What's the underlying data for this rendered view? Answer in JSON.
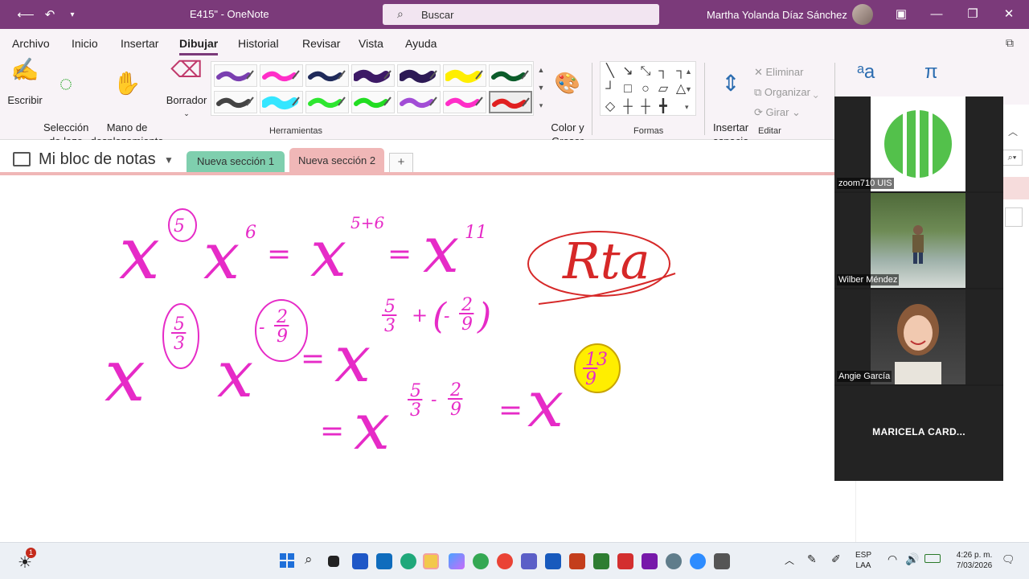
{
  "app": {
    "title": "E415\"  -  OneNote",
    "search_placeholder": "Buscar",
    "user_name": "Martha Yolanda Díaz Sánchez"
  },
  "menu": {
    "items": [
      "Archivo",
      "Inicio",
      "Insertar",
      "Dibujar",
      "Historial",
      "Revisar",
      "Vista",
      "Ayuda"
    ],
    "active": "Dibujar"
  },
  "ribbon": {
    "write": "Escribir",
    "lasso": "Selección\nde lazo",
    "hand": "Mano de\ndesplazamiento",
    "eraser": "Borrador",
    "color": "Color y\nGrosor",
    "insert_space": "Insertar\nespacio",
    "delete": "Eliminar",
    "arrange": "Organizar",
    "rotate": "Girar",
    "groups": {
      "tools": "Herramientas",
      "shapes": "Formas",
      "edit": "Editar"
    },
    "pen_colors": [
      "#7a3fb0",
      "#ff2ec8",
      "#1f2a5a",
      "#3d1a66",
      "#2d1a55",
      "#ffee00",
      "#0b5c2a",
      "#444444",
      "#35e6ff",
      "#2ee630",
      "#22dd22",
      "#a24dd6",
      "#ff2ec8",
      "#e02020"
    ]
  },
  "notebook": {
    "name": "Mi bloc de notas",
    "sections": [
      "Nueva sección 1",
      "Nueva sección 2"
    ],
    "add": "+"
  },
  "ink": {
    "line1": [
      "x",
      "5",
      "x",
      "6",
      "=",
      "x",
      "5+6",
      "=",
      "x",
      "11"
    ],
    "line2": [
      "x",
      "5",
      "3",
      "x",
      "-",
      "2",
      "9",
      "=",
      "x",
      "5",
      "3",
      "+",
      "(",
      "-",
      "2",
      "9",
      ")"
    ],
    "line3": [
      "=",
      "x",
      "5",
      "3",
      "-",
      "2",
      "9",
      "=",
      "x",
      "13",
      "9"
    ],
    "answer_label": "Rta"
  },
  "zoom": {
    "participants": [
      {
        "name": "zoom710 UIS"
      },
      {
        "name": "Wilber Méndez"
      },
      {
        "name": "Angie García"
      },
      {
        "name": "MARICELA  CARD..."
      }
    ],
    "logo_text": "UIS"
  },
  "taskbar": {
    "lang": "ESP\nLAA",
    "time": "4:26 p. m.",
    "date": "7/03/2026",
    "weather_badge": "1"
  },
  "colors": {
    "titlebar": "#7b3a7a",
    "ink_magenta": "#e62bc7",
    "ink_red": "#d62828",
    "highlight_yellow": "#ffee00"
  }
}
